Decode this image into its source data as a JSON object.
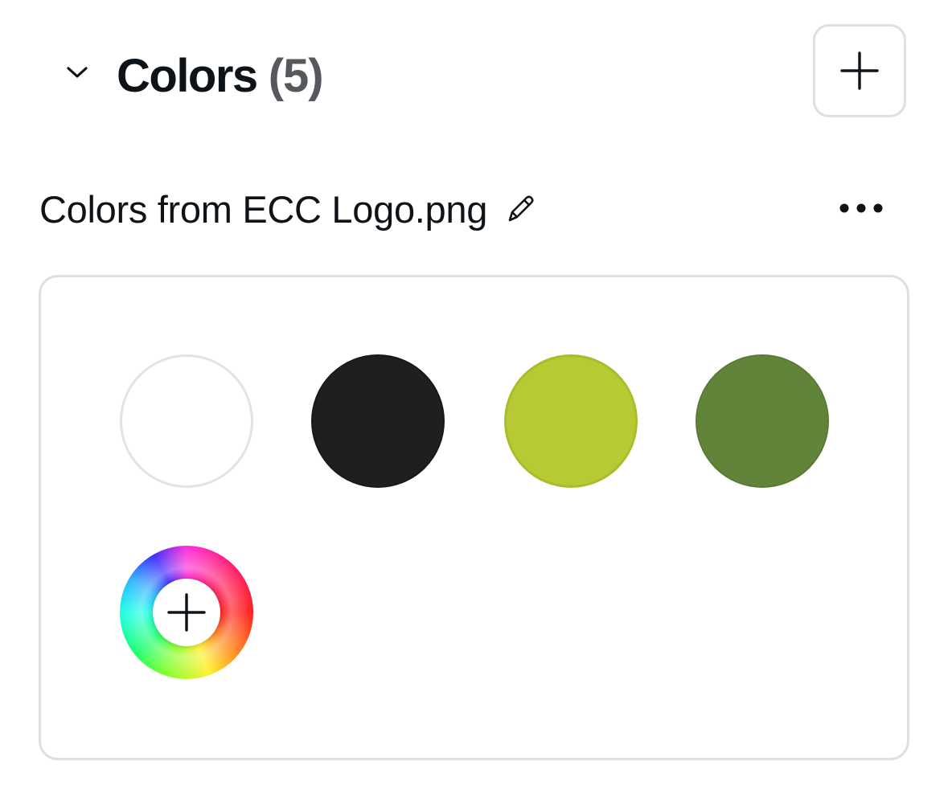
{
  "section": {
    "title": "Colors",
    "count": "(5)",
    "toggle_icon": "chevron-down-icon",
    "add_icon": "plus-icon"
  },
  "palette": {
    "name": "Colors from ECC Logo.png",
    "edit_icon": "pencil-icon",
    "more_icon": "more-horizontal-icon",
    "swatches": [
      {
        "color": "#ffffff"
      },
      {
        "color": "#211f1e"
      },
      {
        "color": "#b8ca33"
      },
      {
        "color": "#62843a"
      }
    ],
    "add_color_icon": "color-wheel-plus-icon"
  },
  "colors": {
    "text": "#0e1318",
    "muted_text": "#55595e",
    "border": "#dedfe1"
  }
}
